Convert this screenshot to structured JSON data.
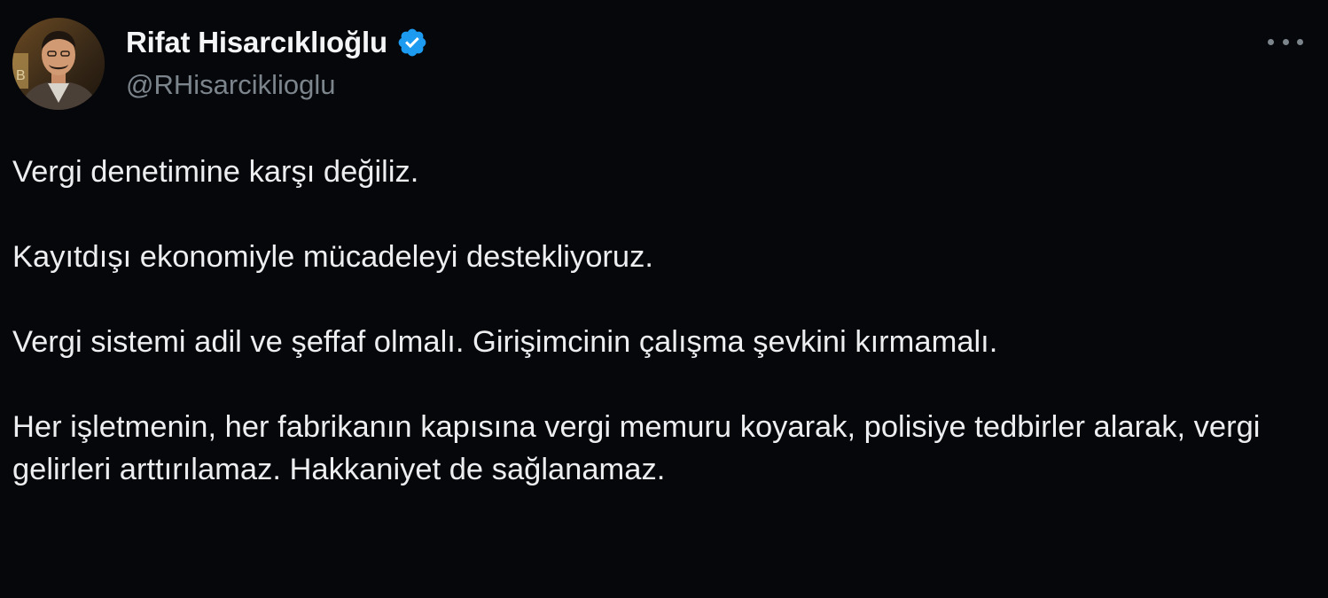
{
  "author": {
    "display_name": "Rifat Hisarcıklıoğlu",
    "handle": "@RHisarciklioglu",
    "verified": true,
    "avatar_icon": "profile-photo",
    "verified_icon": "verified-badge-icon",
    "verified_color": "#1d9bf0"
  },
  "menu": {
    "icon": "more-horizontal-icon"
  },
  "tweet": {
    "paragraphs": [
      "Vergi denetimine karşı değiliz.",
      "Kayıtdışı ekonomiyle mücadeleyi destekliyoruz.",
      "Vergi sistemi adil ve şeffaf olmalı. Girişimcinin çalışma şevkini kırmamalı.",
      "Her işletmenin, her fabrikanın kapısına vergi memuru koyarak, polisiye tedbirler alarak, vergi gelirleri arttırılamaz. Hakkaniyet de sağlanamaz."
    ]
  },
  "colors": {
    "background": "#05070b",
    "text": "#e7e9ea",
    "secondary_text": "#7c848c"
  }
}
